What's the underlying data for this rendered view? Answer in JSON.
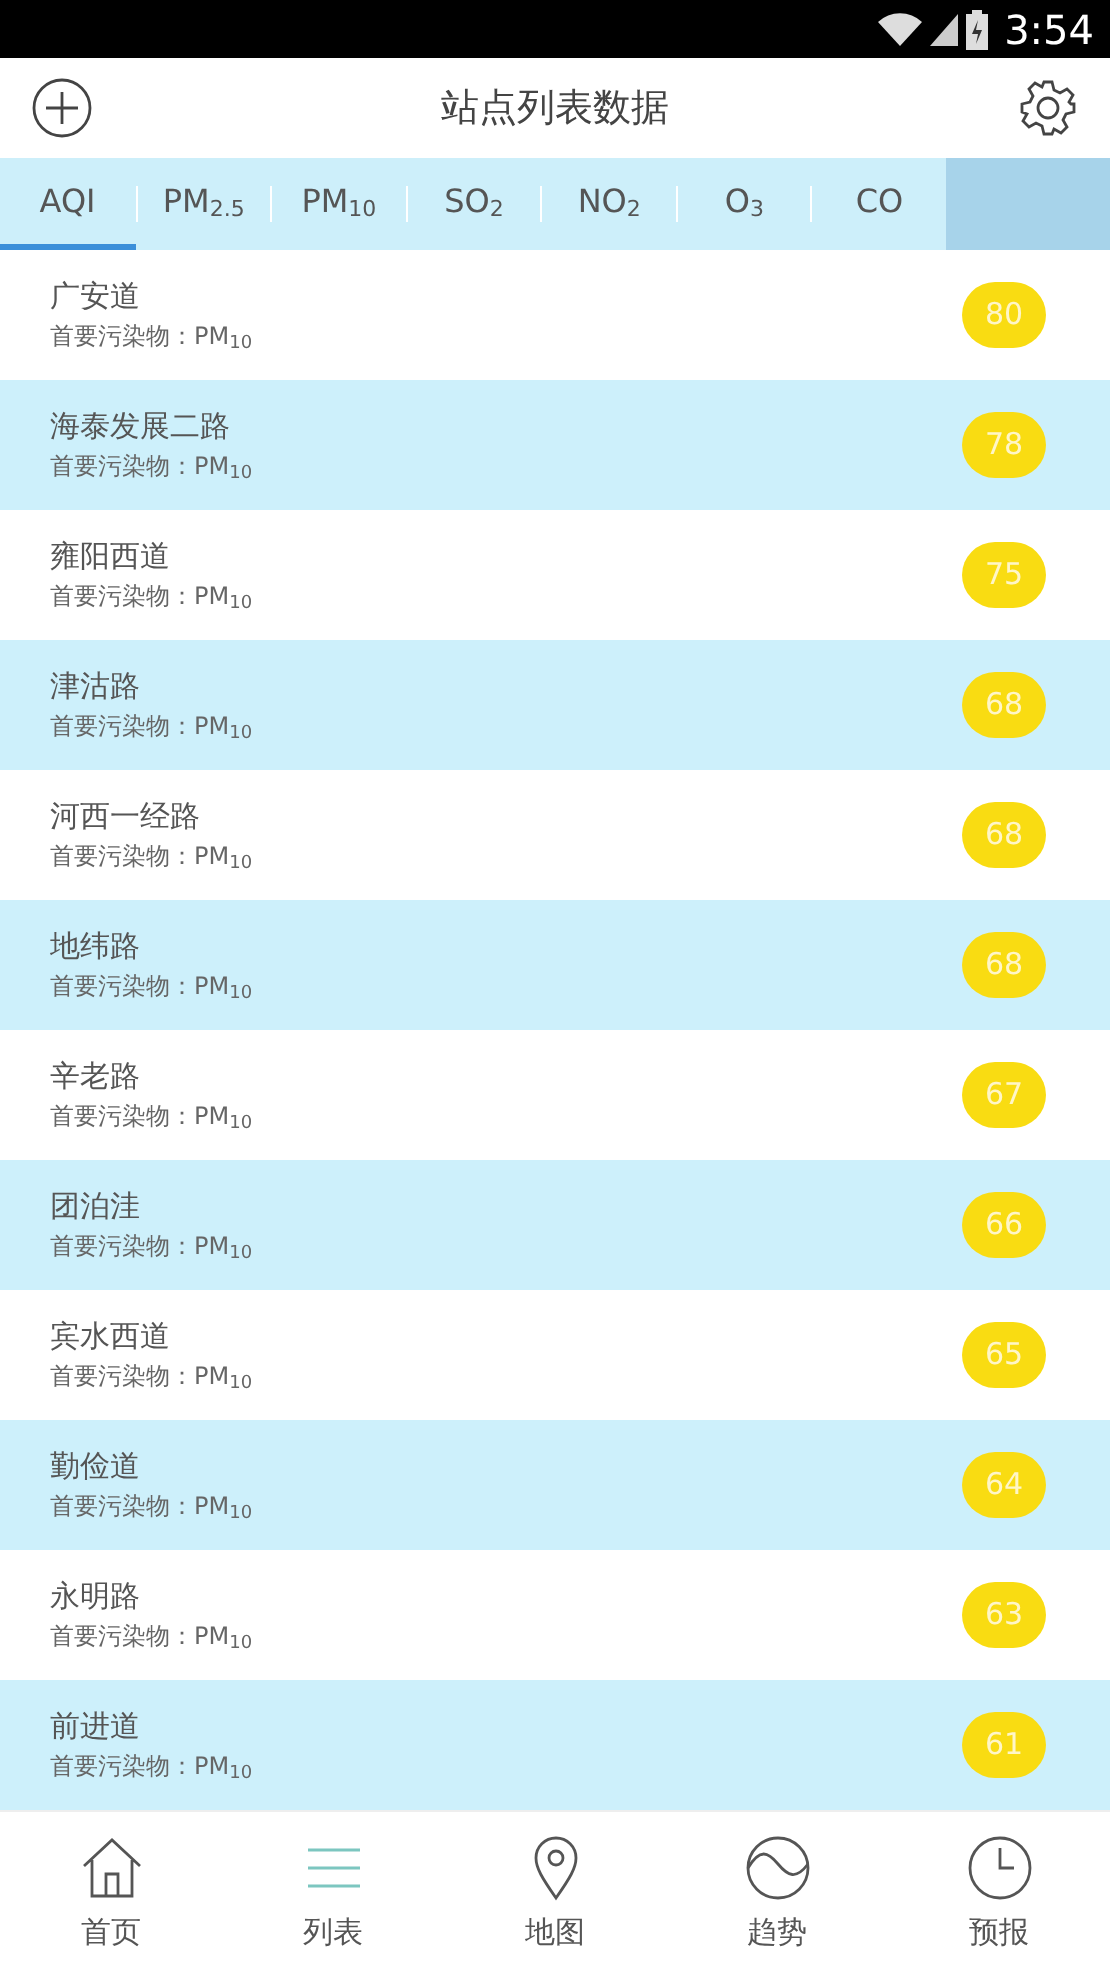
{
  "status_bar": {
    "time": "3:54"
  },
  "header": {
    "title": "站点列表数据"
  },
  "tabs": [
    {
      "label": "AQI",
      "selected": true
    },
    {
      "label": "PM$_{2.5}$",
      "selected": false
    },
    {
      "label": "PM$_{10}$",
      "selected": false
    },
    {
      "label": "SO$_{2}$",
      "selected": false
    },
    {
      "label": "NO$_{2}$",
      "selected": false
    },
    {
      "label": "O$_{3}$",
      "selected": false
    },
    {
      "label": "CO",
      "selected": false
    }
  ],
  "stations": [
    {
      "name": "广安道",
      "pollutant": "首要污染物：PM$_{10}$",
      "aqi": "80"
    },
    {
      "name": "海泰发展二路",
      "pollutant": "首要污染物：PM$_{10}$",
      "aqi": "78"
    },
    {
      "name": "雍阳西道",
      "pollutant": "首要污染物：PM$_{10}$",
      "aqi": "75"
    },
    {
      "name": "津沽路",
      "pollutant": "首要污染物：PM$_{10}$",
      "aqi": "68"
    },
    {
      "name": "河西一经路",
      "pollutant": "首要污染物：PM$_{10}$",
      "aqi": "68"
    },
    {
      "name": "地纬路",
      "pollutant": "首要污染物：PM$_{10}$",
      "aqi": "68"
    },
    {
      "name": "辛老路",
      "pollutant": "首要污染物：PM$_{10}$",
      "aqi": "67"
    },
    {
      "name": "团泊洼",
      "pollutant": "首要污染物：PM$_{10}$",
      "aqi": "66"
    },
    {
      "name": "宾水西道",
      "pollutant": "首要污染物：PM$_{10}$",
      "aqi": "65"
    },
    {
      "name": "勤俭道",
      "pollutant": "首要污染物：PM$_{10}$",
      "aqi": "64"
    },
    {
      "name": "永明路",
      "pollutant": "首要污染物：PM$_{10}$",
      "aqi": "63"
    },
    {
      "name": "前进道",
      "pollutant": "首要污染物：PM$_{10}$",
      "aqi": "61"
    }
  ],
  "bottom_nav": [
    {
      "label": "首页",
      "kind": "home",
      "selected": false
    },
    {
      "label": "列表",
      "kind": "list",
      "selected": true
    },
    {
      "label": "地图",
      "kind": "map",
      "selected": false
    },
    {
      "label": "趋势",
      "kind": "trend",
      "selected": false
    },
    {
      "label": "预报",
      "kind": "forecast",
      "selected": false
    }
  ]
}
